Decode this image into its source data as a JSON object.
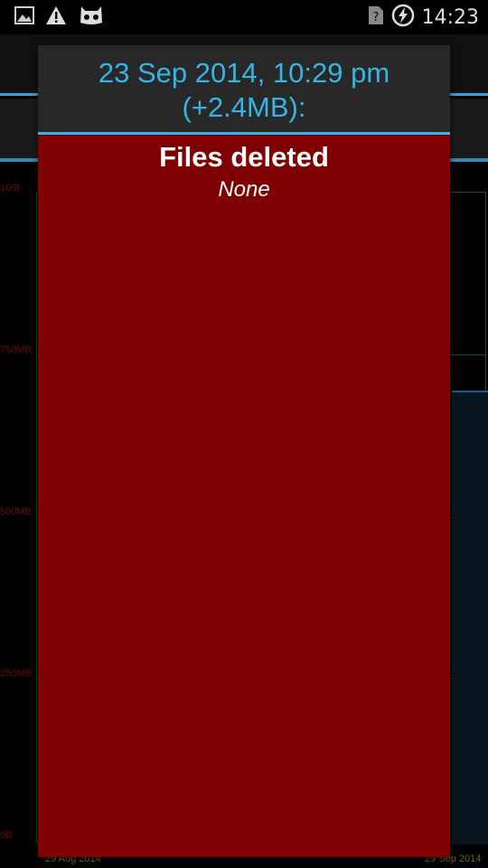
{
  "status_bar": {
    "time": "14:23",
    "icons": [
      "image-icon",
      "warning-icon",
      "cyanogenmod-icon",
      "no-sim-icon",
      "battery-charging-icon"
    ]
  },
  "chart_data": {
    "type": "area",
    "y_tick_labels": [
      "1GB",
      "750MB",
      "500MB",
      "250MB",
      "0B"
    ],
    "x_tick_labels": [
      "29 Aug 2014",
      "29 Sep 2014"
    ]
  },
  "dialog": {
    "title": "23 Sep 2014, 10:29 pm\n(+2.4MB):",
    "section_title": "Files deleted",
    "section_value": "None"
  },
  "colors": {
    "accent": "#33b5e5",
    "dialog_background": "#7f0000",
    "header_background": "#282828"
  }
}
